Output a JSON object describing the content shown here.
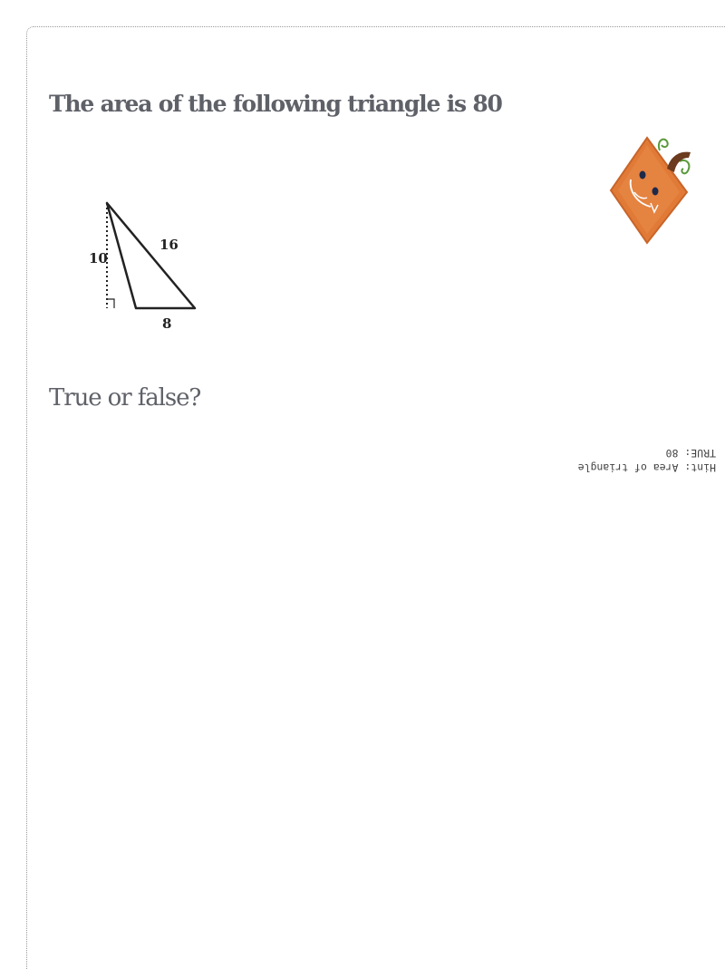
{
  "question": {
    "title": "The area of the following triangle is 80",
    "prompt": "True or false?"
  },
  "figure": {
    "height_label": "10",
    "side_label": "16",
    "base_label": "8"
  },
  "hint": {
    "line1": "Hint: Area of triangle",
    "line2": "TRUE: 80"
  },
  "mascot": {
    "icon": "pumpkin-mascot-icon",
    "body_color": "#e07a36",
    "stem_color": "#6b3a1f",
    "vine_color": "#5a9a3a"
  }
}
